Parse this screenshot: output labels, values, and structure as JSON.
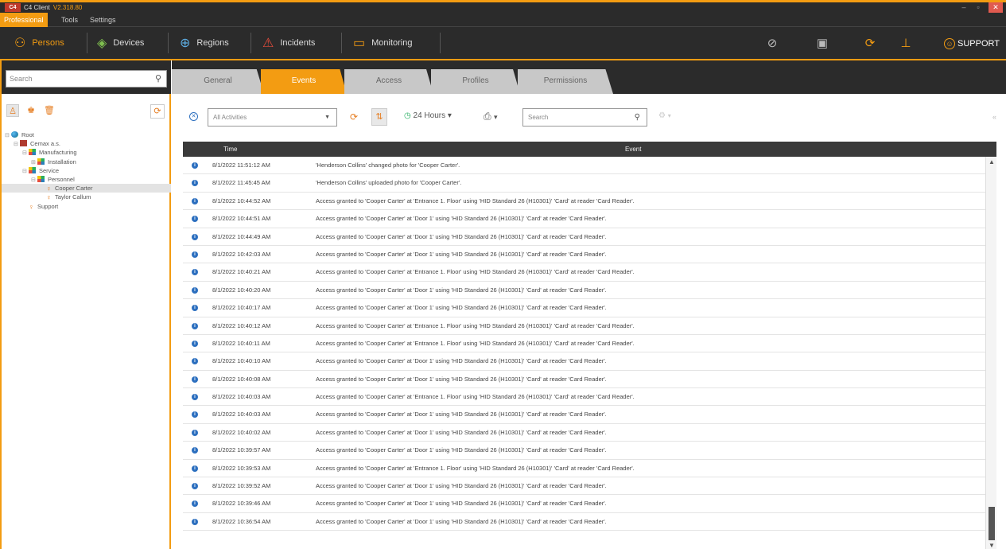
{
  "window": {
    "app_name": "C4 Client",
    "version": "V2.318.80",
    "logo_text": "C4",
    "min": "–",
    "max": "▫",
    "close": "✕"
  },
  "menu": {
    "items": [
      "Professional",
      "Tools",
      "Settings"
    ]
  },
  "nav": {
    "persons": "Persons",
    "devices": "Devices",
    "regions": "Regions",
    "incidents": "Incidents",
    "monitoring": "Monitoring",
    "support": "SUPPORT"
  },
  "left": {
    "search_placeholder": "Search",
    "tree": [
      {
        "label": "Root",
        "level": 0,
        "icon": "globe",
        "exp": "⊟"
      },
      {
        "label": "Cemax a.s.",
        "level": 1,
        "icon": "company",
        "exp": "⊟"
      },
      {
        "label": "Manufacturing",
        "level": 2,
        "icon": "dept",
        "exp": "⊟"
      },
      {
        "label": "Installation",
        "level": 3,
        "icon": "dept",
        "exp": "⊞"
      },
      {
        "label": "Service",
        "level": 2,
        "icon": "dept",
        "exp": "⊟"
      },
      {
        "label": "Personnel",
        "level": 3,
        "icon": "dept",
        "exp": "⊟"
      },
      {
        "label": "Cooper Carter",
        "level": 4,
        "icon": "person",
        "exp": "",
        "selected": true
      },
      {
        "label": "Taylor Callum",
        "level": 4,
        "icon": "person",
        "exp": ""
      },
      {
        "label": "Support",
        "level": 2,
        "icon": "person",
        "exp": ""
      }
    ]
  },
  "tabs": [
    "General",
    "Events",
    "Access",
    "Profiles",
    "Permissions"
  ],
  "filter": {
    "activities": "All Activities",
    "hours": "24 Hours",
    "search_placeholder": "Search",
    "collapse": "«"
  },
  "table": {
    "headers": {
      "time": "Time",
      "event": "Event"
    },
    "rows": [
      {
        "time": "8/1/2022 11:51:12 AM",
        "event": "'Henderson Collins' changed photo for 'Cooper Carter'."
      },
      {
        "time": "8/1/2022 11:45:45 AM",
        "event": "'Henderson Collins' uploaded photo for 'Cooper Carter'."
      },
      {
        "time": "8/1/2022 10:44:52 AM",
        "event": "Access granted to 'Cooper Carter' at 'Entrance 1. Floor' using 'HID Standard 26 (H10301)' 'Card' at reader 'Card Reader'."
      },
      {
        "time": "8/1/2022 10:44:51 AM",
        "event": "Access granted to 'Cooper Carter' at 'Door 1' using 'HID Standard 26 (H10301)' 'Card' at reader 'Card Reader'."
      },
      {
        "time": "8/1/2022 10:44:49 AM",
        "event": "Access granted to 'Cooper Carter' at 'Door 1' using 'HID Standard 26 (H10301)' 'Card' at reader 'Card Reader'."
      },
      {
        "time": "8/1/2022 10:42:03 AM",
        "event": "Access granted to 'Cooper Carter' at 'Door 1' using 'HID Standard 26 (H10301)' 'Card' at reader 'Card Reader'."
      },
      {
        "time": "8/1/2022 10:40:21 AM",
        "event": "Access granted to 'Cooper Carter' at 'Entrance 1. Floor' using 'HID Standard 26 (H10301)' 'Card' at reader 'Card Reader'."
      },
      {
        "time": "8/1/2022 10:40:20 AM",
        "event": "Access granted to 'Cooper Carter' at 'Door 1' using 'HID Standard 26 (H10301)' 'Card' at reader 'Card Reader'."
      },
      {
        "time": "8/1/2022 10:40:17 AM",
        "event": "Access granted to 'Cooper Carter' at 'Door 1' using 'HID Standard 26 (H10301)' 'Card' at reader 'Card Reader'."
      },
      {
        "time": "8/1/2022 10:40:12 AM",
        "event": "Access granted to 'Cooper Carter' at 'Entrance 1. Floor' using 'HID Standard 26 (H10301)' 'Card' at reader 'Card Reader'."
      },
      {
        "time": "8/1/2022 10:40:11 AM",
        "event": "Access granted to 'Cooper Carter' at 'Entrance 1. Floor' using 'HID Standard 26 (H10301)' 'Card' at reader 'Card Reader'."
      },
      {
        "time": "8/1/2022 10:40:10 AM",
        "event": "Access granted to 'Cooper Carter' at 'Door 1' using 'HID Standard 26 (H10301)' 'Card' at reader 'Card Reader'."
      },
      {
        "time": "8/1/2022 10:40:08 AM",
        "event": "Access granted to 'Cooper Carter' at 'Door 1' using 'HID Standard 26 (H10301)' 'Card' at reader 'Card Reader'."
      },
      {
        "time": "8/1/2022 10:40:03 AM",
        "event": "Access granted to 'Cooper Carter' at 'Entrance 1. Floor' using 'HID Standard 26 (H10301)' 'Card' at reader 'Card Reader'."
      },
      {
        "time": "8/1/2022 10:40:03 AM",
        "event": "Access granted to 'Cooper Carter' at 'Door 1' using 'HID Standard 26 (H10301)' 'Card' at reader 'Card Reader'."
      },
      {
        "time": "8/1/2022 10:40:02 AM",
        "event": "Access granted to 'Cooper Carter' at 'Door 1' using 'HID Standard 26 (H10301)' 'Card' at reader 'Card Reader'."
      },
      {
        "time": "8/1/2022 10:39:57 AM",
        "event": "Access granted to 'Cooper Carter' at 'Door 1' using 'HID Standard 26 (H10301)' 'Card' at reader 'Card Reader'."
      },
      {
        "time": "8/1/2022 10:39:53 AM",
        "event": "Access granted to 'Cooper Carter' at 'Entrance 1. Floor' using 'HID Standard 26 (H10301)' 'Card' at reader 'Card Reader'."
      },
      {
        "time": "8/1/2022 10:39:52 AM",
        "event": "Access granted to 'Cooper Carter' at 'Door 1' using 'HID Standard 26 (H10301)' 'Card' at reader 'Card Reader'."
      },
      {
        "time": "8/1/2022 10:39:46 AM",
        "event": "Access granted to 'Cooper Carter' at 'Door 1' using 'HID Standard 26 (H10301)' 'Card' at reader 'Card Reader'."
      },
      {
        "time": "8/1/2022 10:36:54 AM",
        "event": "Access granted to 'Cooper Carter' at 'Door 1' using 'HID Standard 26 (H10301)' 'Card' at reader 'Card Reader'."
      }
    ]
  },
  "colors": {
    "accent": "#f39c12",
    "dark": "#2b2b2b",
    "info": "#2c6fbf"
  }
}
